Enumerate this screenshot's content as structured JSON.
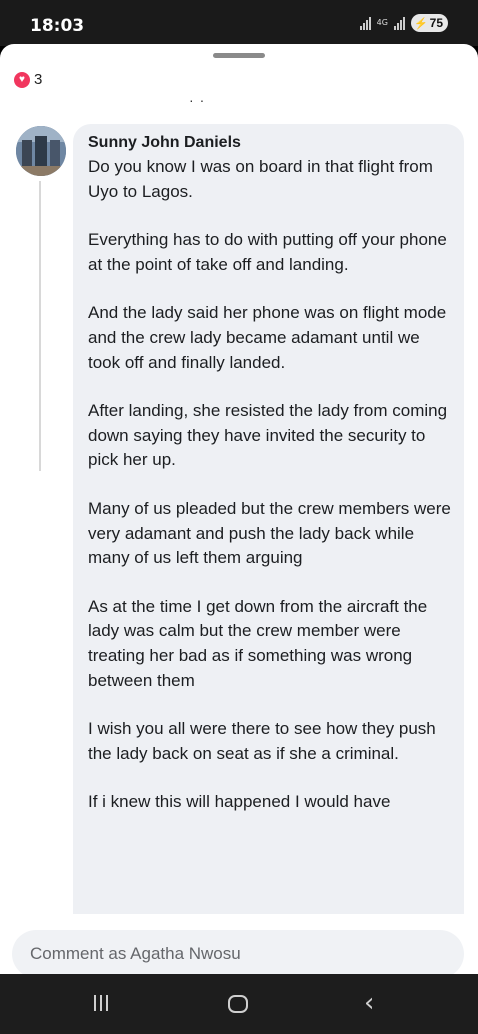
{
  "status_bar": {
    "time": "18:03",
    "network_label": "4G",
    "battery": "75"
  },
  "reactions": {
    "icon": "heart-icon",
    "color": "#f1365e",
    "count": "3"
  },
  "comment": {
    "author": "Sunny John Daniels",
    "paragraphs": [
      "Do you know I was on board in that flight from Uyo to Lagos.",
      "Everything has to do with putting off your phone at the point of take off and landing.",
      "And the lady said her phone was on flight mode and the crew lady became adamant until we took off and finally landed.",
      "After landing, she resisted the lady from coming down saying they have invited the security to pick her up.",
      "Many of us pleaded but the crew members were very adamant and push the lady back while many of us left them arguing",
      "As at the time I get down from the aircraft the lady was calm but the crew member were treating her bad as if something was wrong between them",
      "I wish you all were there to see how they push the lady back on seat as if she a criminal.",
      "If i knew this will happened I would have"
    ]
  },
  "composer": {
    "placeholder": "Comment as Agatha Nwosu"
  },
  "nav": {
    "recent": "recent-apps-icon",
    "home": "home-icon",
    "back": "back-icon"
  }
}
